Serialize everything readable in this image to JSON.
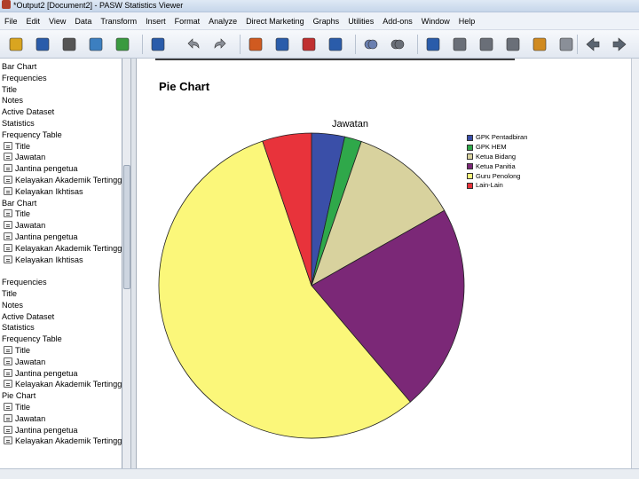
{
  "window": {
    "title": "*Output2 [Document2] - PASW Statistics Viewer"
  },
  "menu": [
    "File",
    "Edit",
    "View",
    "Data",
    "Transform",
    "Insert",
    "Format",
    "Analyze",
    "Direct Marketing",
    "Graphs",
    "Utilities",
    "Add-ons",
    "Window",
    "Help"
  ],
  "toolbar": {
    "buttons": [
      {
        "name": "open-icon",
        "color": "#d9a520"
      },
      {
        "name": "save-icon",
        "color": "#2a5caa"
      },
      {
        "name": "print-icon",
        "color": "#555555"
      },
      {
        "name": "print-preview-icon",
        "color": "#3c7fc0"
      },
      {
        "name": "export-icon",
        "color": "#3a9a40"
      },
      {
        "name": "recall-dialog-icon",
        "color": "#2a5caa"
      },
      {
        "name": "undo-icon",
        "color": "#8a8f98"
      },
      {
        "name": "redo-icon",
        "color": "#8a8f98"
      },
      {
        "name": "goto-data-icon",
        "color": "#d05a20"
      },
      {
        "name": "goto-case-icon",
        "color": "#2a5caa"
      },
      {
        "name": "insert-variable-icon",
        "color": "#c03030"
      },
      {
        "name": "variables-icon",
        "color": "#2a5caa"
      },
      {
        "name": "show-all-icon",
        "color": "#6a7fb0"
      },
      {
        "name": "hide-icon",
        "color": "#6a6f78"
      },
      {
        "name": "promote-icon",
        "color": "#2a5caa"
      },
      {
        "name": "collapse-icon",
        "color": "#6a6f78"
      },
      {
        "name": "expand-icon",
        "color": "#6a6f78"
      },
      {
        "name": "insert-title-icon",
        "color": "#6a6f78"
      },
      {
        "name": "insert-text-icon",
        "color": "#d08a20"
      },
      {
        "name": "designated-window-icon",
        "color": "#8a8f98"
      },
      {
        "name": "back-arrow-icon",
        "color": "#5a6470"
      },
      {
        "name": "forward-arrow-icon",
        "color": "#5a6470"
      }
    ]
  },
  "outline": {
    "items": [
      {
        "label": "Bar Chart",
        "icon": false
      },
      {
        "label": "Frequencies",
        "icon": false
      },
      {
        "label": "Title",
        "icon": false
      },
      {
        "label": "Notes",
        "icon": false
      },
      {
        "label": "Active Dataset",
        "icon": false
      },
      {
        "label": "Statistics",
        "icon": false
      },
      {
        "label": "Frequency Table",
        "icon": false
      },
      {
        "label": "Title",
        "icon": true
      },
      {
        "label": "Jawatan",
        "icon": true
      },
      {
        "label": "Jantina pengetua",
        "icon": true
      },
      {
        "label": "Kelayakan Akademik Tertinggi",
        "icon": true
      },
      {
        "label": "Kelayakan Ikhtisas",
        "icon": true
      },
      {
        "label": "Bar Chart",
        "icon": false
      },
      {
        "label": "Title",
        "icon": true
      },
      {
        "label": "Jawatan",
        "icon": true
      },
      {
        "label": "Jantina pengetua",
        "icon": true
      },
      {
        "label": "Kelayakan Akademik Tertinggi",
        "icon": true
      },
      {
        "label": "Kelayakan Ikhtisas",
        "icon": true
      },
      {
        "label": "",
        "icon": false
      },
      {
        "label": "Frequencies",
        "icon": false
      },
      {
        "label": "Title",
        "icon": false
      },
      {
        "label": "Notes",
        "icon": false
      },
      {
        "label": "Active Dataset",
        "icon": false
      },
      {
        "label": "Statistics",
        "icon": false
      },
      {
        "label": "Frequency Table",
        "icon": false
      },
      {
        "label": "Title",
        "icon": true
      },
      {
        "label": "Jawatan",
        "icon": true
      },
      {
        "label": "Jantina pengetua",
        "icon": true
      },
      {
        "label": "Kelayakan Akademik Tertinggi",
        "icon": true
      },
      {
        "label": "Pie Chart",
        "icon": false
      },
      {
        "label": "Title",
        "icon": true
      },
      {
        "label": "Jawatan",
        "icon": true
      },
      {
        "label": "Jantina pengetua",
        "icon": true
      },
      {
        "label": "Kelayakan Akademik Tertinggi",
        "icon": true
      }
    ]
  },
  "content": {
    "heading": "Pie Chart"
  },
  "chart_data": {
    "type": "pie",
    "title": "Jawatan",
    "labels": [
      "GPK Pentadbiran",
      "GPK HEM",
      "Ketua Bidang",
      "Ketua Panitia",
      "Guru Penolong",
      "Lain-Lain"
    ],
    "values": [
      3.5,
      1.8,
      11.5,
      22.0,
      56.0,
      5.2
    ],
    "colors": [
      "#3a4fa8",
      "#2fa84a",
      "#d8d29e",
      "#7b2877",
      "#fbf77a",
      "#e8333b"
    ],
    "legend": "right"
  }
}
